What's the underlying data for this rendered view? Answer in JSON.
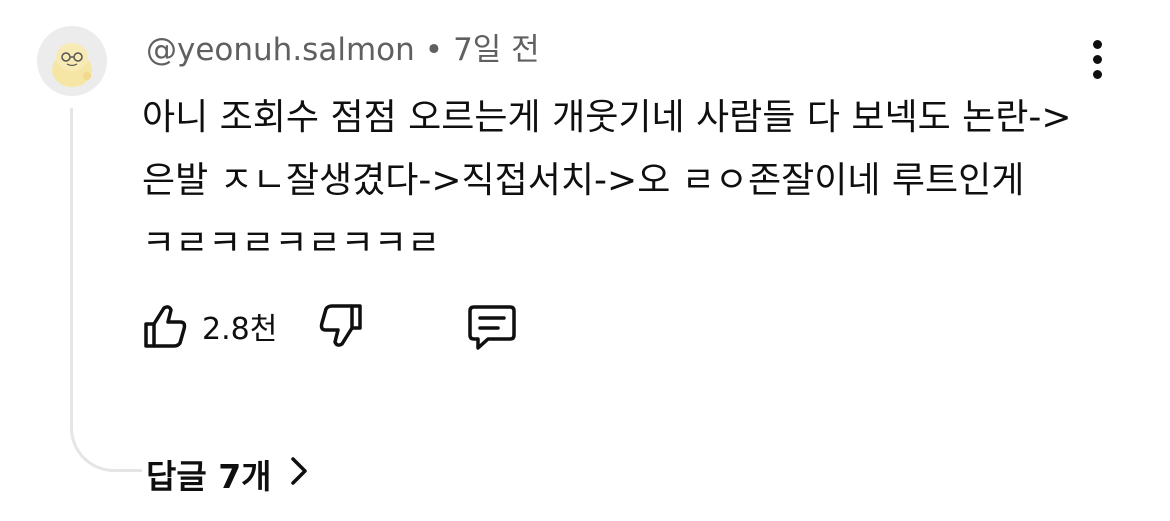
{
  "comment": {
    "author": "@yeonuh.salmon",
    "separator": "•",
    "time": "7일 전",
    "text": "아니 조회수 점점 오르는게 개웃기네 사람들 다 보넥도 논란->은발 ㅈㄴ잘생겼다->직접서치->오 ㄹㅇ존잘이네 루트인게 ㅋㄹㅋㄹㅋㄹㅋㅋㄹ",
    "likes": "2.8천",
    "replies_label": "답글 7개"
  },
  "icons": {
    "avatar": "cartoon-avatar",
    "more": "more-vertical-icon",
    "like": "thumbs-up-icon",
    "dislike": "thumbs-down-icon",
    "reply": "comment-icon",
    "chevron": "chevron-right-icon"
  },
  "colors": {
    "text": "#0f0f0f",
    "secondary": "#606060",
    "thread_line": "#e5e5e5",
    "background": "#ffffff"
  }
}
